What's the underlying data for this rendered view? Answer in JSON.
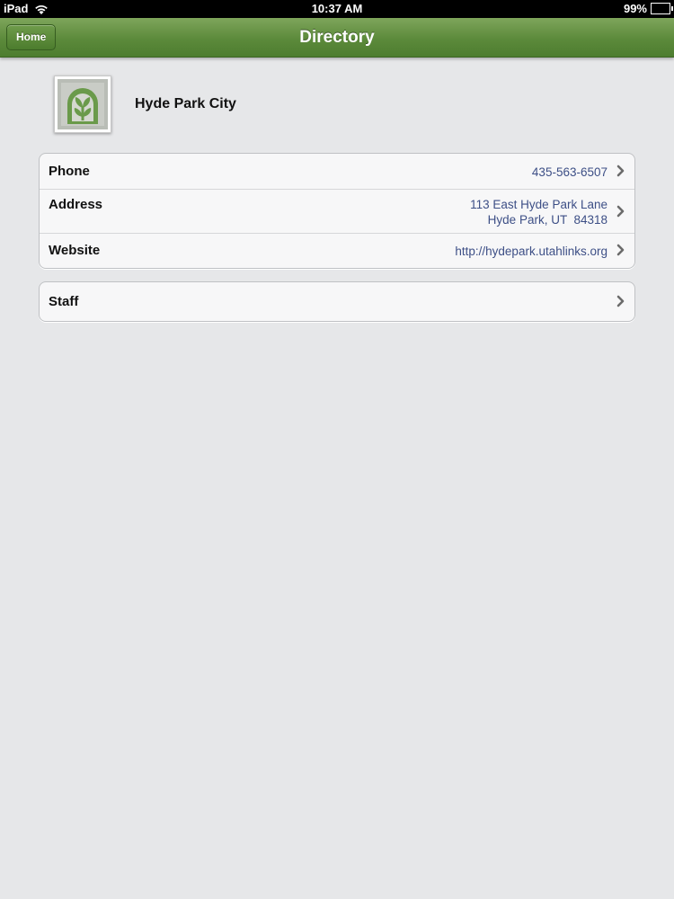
{
  "status_bar": {
    "device": "iPad",
    "time": "10:37 AM",
    "battery": "99%",
    "battery_level": 0.99,
    "wifi_icon": "wifi-icon"
  },
  "nav": {
    "home_label": "Home",
    "title": "Directory",
    "accent_color": "#5c8a3b"
  },
  "organization": {
    "name": "Hyde Park City",
    "logo_icon": "leaf-logo-icon"
  },
  "info_rows": [
    {
      "label": "Phone",
      "value": "435-563-6507"
    },
    {
      "label": "Address",
      "value_line1": "113 East Hyde Park Lane",
      "value_line2": "Hyde Park, UT  84318"
    },
    {
      "label": "Website",
      "value": "http://hydepark.utahlinks.org"
    }
  ],
  "staff_row": {
    "label": "Staff"
  },
  "colors": {
    "link": "#3d4f86",
    "background": "#e6e7e9",
    "logo_green": "#6a9a4a"
  }
}
